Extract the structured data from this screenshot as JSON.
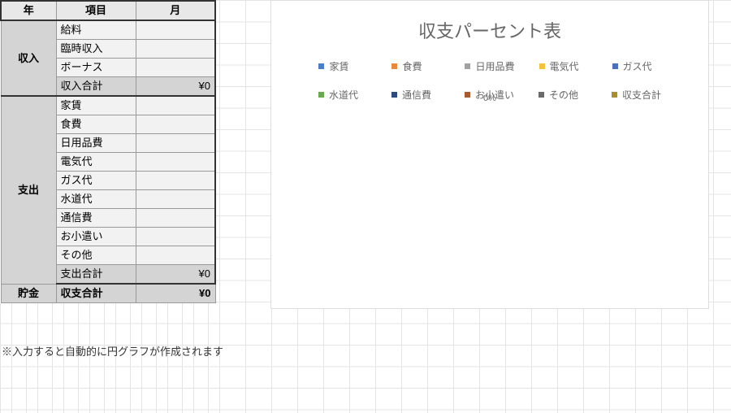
{
  "headers": {
    "year": "年",
    "item": "項目",
    "month": "月"
  },
  "sections": {
    "income": {
      "label": "収入",
      "items": [
        "給料",
        "臨時収入",
        "ボーナス"
      ],
      "subtotal_label": "収入合計",
      "subtotal_value": "¥0"
    },
    "expense": {
      "label": "支出",
      "items": [
        "家賃",
        "食費",
        "日用品費",
        "電気代",
        "ガス代",
        "水道代",
        "通信費",
        "お小遣い",
        "その他"
      ],
      "subtotal_label": "支出合計",
      "subtotal_value": "¥0"
    },
    "savings": {
      "label": "貯金",
      "balance_label": "収支合計",
      "balance_value": "¥0"
    }
  },
  "note": "※入力すると自動的に円グラフが作成されます",
  "chart": {
    "title": "収支パーセント表",
    "center_label": "0%",
    "legend": [
      "家賃",
      "食費",
      "日用品費",
      "電気代",
      "ガス代",
      "水道代",
      "通信費",
      "お小遣い",
      "その他",
      "収支合計"
    ]
  },
  "chart_data": {
    "type": "pie",
    "title": "収支パーセント表",
    "categories": [
      "家賃",
      "食費",
      "日用品費",
      "電気代",
      "ガス代",
      "水道代",
      "通信費",
      "お小遣い",
      "その他",
      "収支合計"
    ],
    "values": [
      0,
      0,
      0,
      0,
      0,
      0,
      0,
      0,
      0,
      0
    ]
  }
}
